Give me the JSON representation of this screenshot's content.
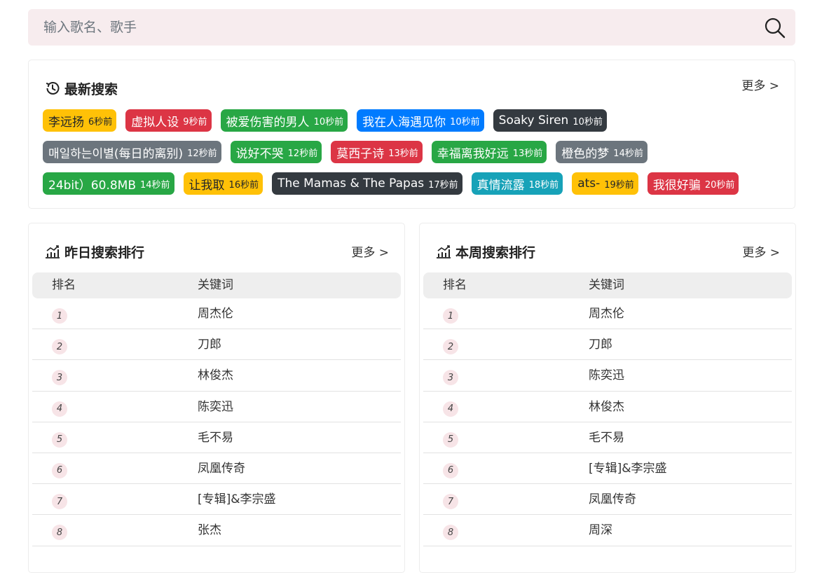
{
  "search": {
    "placeholder": "输入歌名、歌手",
    "value": ""
  },
  "recent": {
    "title": "最新搜索",
    "more": "更多 >",
    "items": [
      {
        "keyword": "李远扬",
        "time": "6秒前",
        "color": "#ffc107"
      },
      {
        "keyword": "虚拟人设",
        "time": "9秒前",
        "color": "#dc3545"
      },
      {
        "keyword": "被爱伤害的男人",
        "time": "10秒前",
        "color": "#28a745"
      },
      {
        "keyword": "我在人海遇见你",
        "time": "10秒前",
        "color": "#007bff"
      },
      {
        "keyword": "Soaky Siren",
        "time": "10秒前",
        "color": "#343a40"
      },
      {
        "keyword": "매일하는이별(每日的离别)",
        "time": "12秒前",
        "color": "#6c757d"
      },
      {
        "keyword": "说好不哭",
        "time": "12秒前",
        "color": "#28a745"
      },
      {
        "keyword": "莫西子诗",
        "time": "13秒前",
        "color": "#dc3545"
      },
      {
        "keyword": "幸福离我好远",
        "time": "13秒前",
        "color": "#28a745"
      },
      {
        "keyword": "橙色的梦",
        "time": "14秒前",
        "color": "#6c757d"
      },
      {
        "keyword": "24bit）60.8MB",
        "time": "14秒前",
        "color": "#28a745"
      },
      {
        "keyword": "让我取",
        "time": "16秒前",
        "color": "#ffc107"
      },
      {
        "keyword": "The Mamas & The Papas",
        "time": "17秒前",
        "color": "#343a40"
      },
      {
        "keyword": "真情流露",
        "time": "18秒前",
        "color": "#17a2b8"
      },
      {
        "keyword": "ats-",
        "time": "19秒前",
        "color": "#ffc107"
      },
      {
        "keyword": "我很好骗",
        "time": "20秒前",
        "color": "#dc3545"
      }
    ]
  },
  "yesterday": {
    "title": "昨日搜索排行",
    "more": "更多 >",
    "col_rank": "排名",
    "col_keyword": "关键词",
    "rows": [
      {
        "rank": "1",
        "keyword": "周杰伦"
      },
      {
        "rank": "2",
        "keyword": "刀郎"
      },
      {
        "rank": "3",
        "keyword": "林俊杰"
      },
      {
        "rank": "4",
        "keyword": "陈奕迅"
      },
      {
        "rank": "5",
        "keyword": "毛不易"
      },
      {
        "rank": "6",
        "keyword": "凤凰传奇"
      },
      {
        "rank": "7",
        "keyword": "[专辑]&李宗盛"
      },
      {
        "rank": "8",
        "keyword": "张杰"
      }
    ]
  },
  "week": {
    "title": "本周搜索排行",
    "more": "更多 >",
    "col_rank": "排名",
    "col_keyword": "关键词",
    "rows": [
      {
        "rank": "1",
        "keyword": "周杰伦"
      },
      {
        "rank": "2",
        "keyword": "刀郎"
      },
      {
        "rank": "3",
        "keyword": "陈奕迅"
      },
      {
        "rank": "4",
        "keyword": "林俊杰"
      },
      {
        "rank": "5",
        "keyword": "毛不易"
      },
      {
        "rank": "6",
        "keyword": "[专辑]&李宗盛"
      },
      {
        "rank": "7",
        "keyword": "凤凰传奇"
      },
      {
        "rank": "8",
        "keyword": "周深"
      }
    ]
  },
  "icons": {
    "search": "search-icon",
    "history": "history-icon",
    "chart": "chart-icon"
  }
}
